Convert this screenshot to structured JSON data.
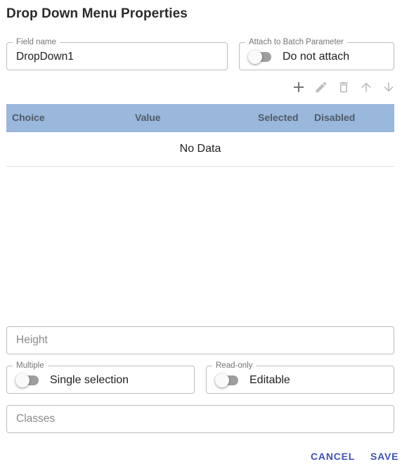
{
  "dialog": {
    "title": "Drop Down Menu Properties"
  },
  "field_name": {
    "legend": "Field name",
    "value": "DropDown1"
  },
  "attach": {
    "legend": "Attach to Batch Parameter",
    "label": "Do not attach",
    "on": false
  },
  "toolbar": {
    "icons": [
      "add-icon",
      "edit-icon",
      "delete-icon",
      "arrow-up-icon",
      "arrow-down-icon"
    ],
    "icon_color": "#757575",
    "disabled_color": "#bdbdbd"
  },
  "table": {
    "columns": [
      "Choice",
      "Value",
      "Selected",
      "Disabled"
    ],
    "empty_text": "No Data",
    "header_color": "#99b8db"
  },
  "height": {
    "placeholder": "Height"
  },
  "multiple": {
    "legend": "Multiple",
    "label": "Single selection",
    "on": false
  },
  "readonly": {
    "legend": "Read-only",
    "label": "Editable",
    "on": false
  },
  "classes": {
    "placeholder": "Classes"
  },
  "actions": {
    "cancel": "CANCEL",
    "save": "SAVE",
    "color": "#3f51b5"
  }
}
